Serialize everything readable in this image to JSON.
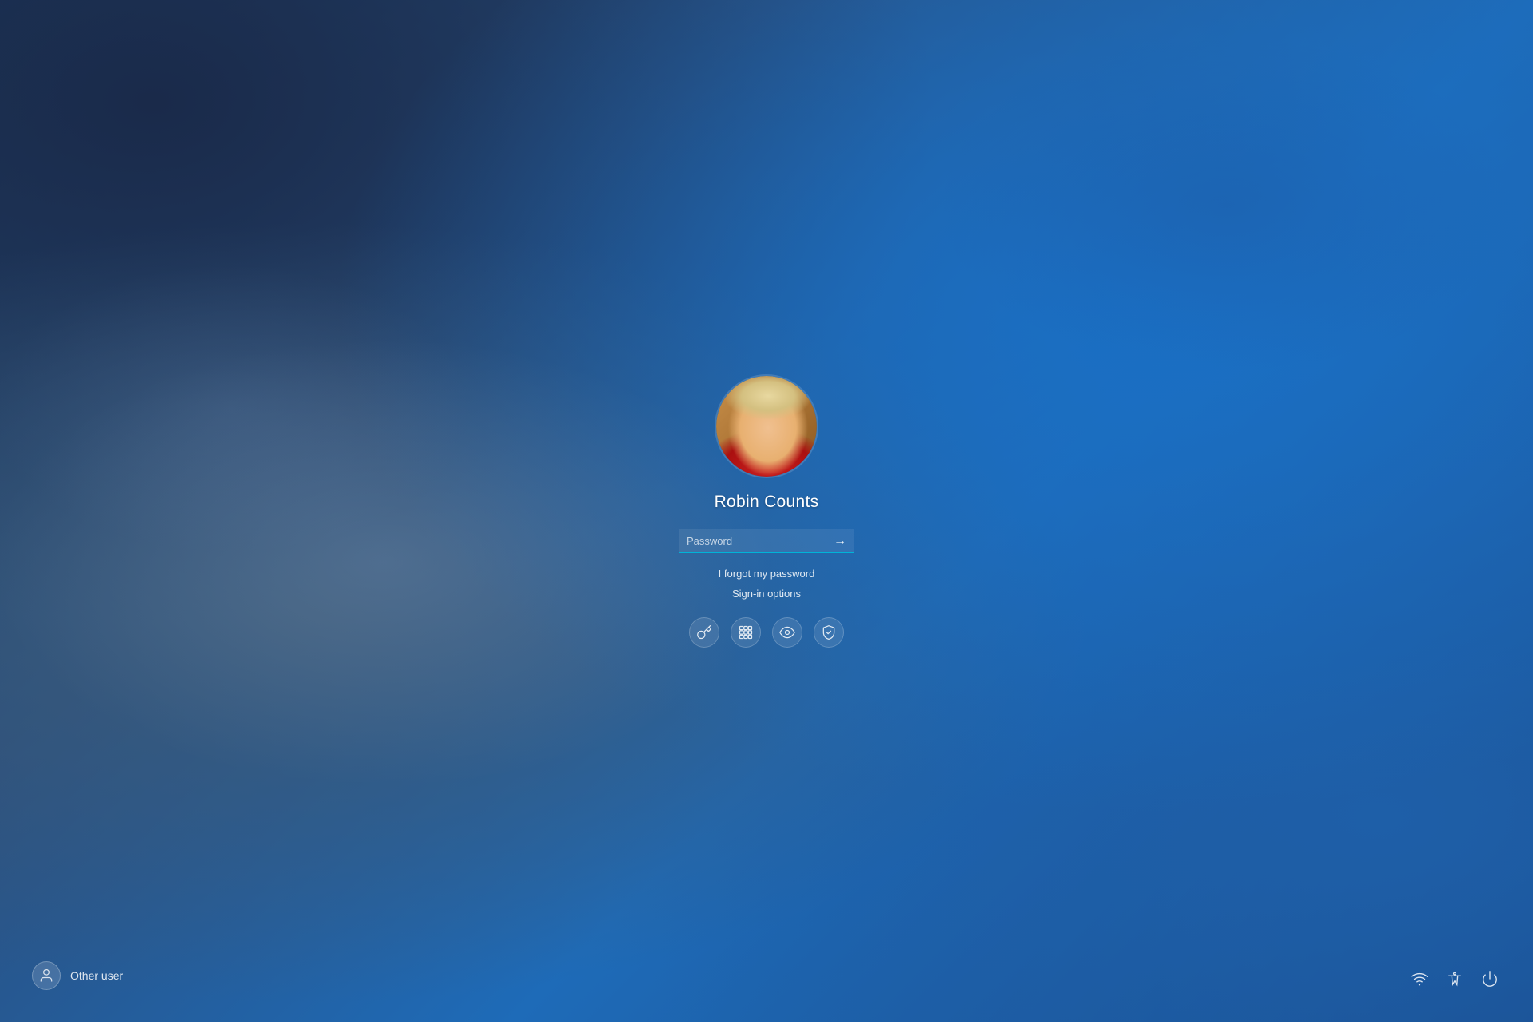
{
  "background": {
    "description": "Windows login screen blue gradient background"
  },
  "user": {
    "name": "Robin Counts",
    "avatar_alt": "Robin Counts profile photo"
  },
  "password_field": {
    "placeholder": "Password",
    "value": ""
  },
  "links": {
    "forgot_password": "I forgot my password",
    "signin_options": "Sign-in options"
  },
  "signin_icons": [
    {
      "name": "key-icon",
      "label": "Password",
      "symbol": "🗝"
    },
    {
      "name": "pin-icon",
      "label": "PIN",
      "symbol": "⊞"
    },
    {
      "name": "fingerprint-icon",
      "label": "Fingerprint",
      "symbol": "👁"
    },
    {
      "name": "badge-icon",
      "label": "Security key",
      "symbol": "🔰"
    }
  ],
  "other_user": {
    "label": "Other user",
    "icon": "person-icon"
  },
  "bottom_icons": [
    {
      "name": "wifi-icon",
      "label": "Network"
    },
    {
      "name": "accessibility-icon",
      "label": "Accessibility"
    },
    {
      "name": "power-icon",
      "label": "Power"
    }
  ],
  "submit_arrow": "→"
}
